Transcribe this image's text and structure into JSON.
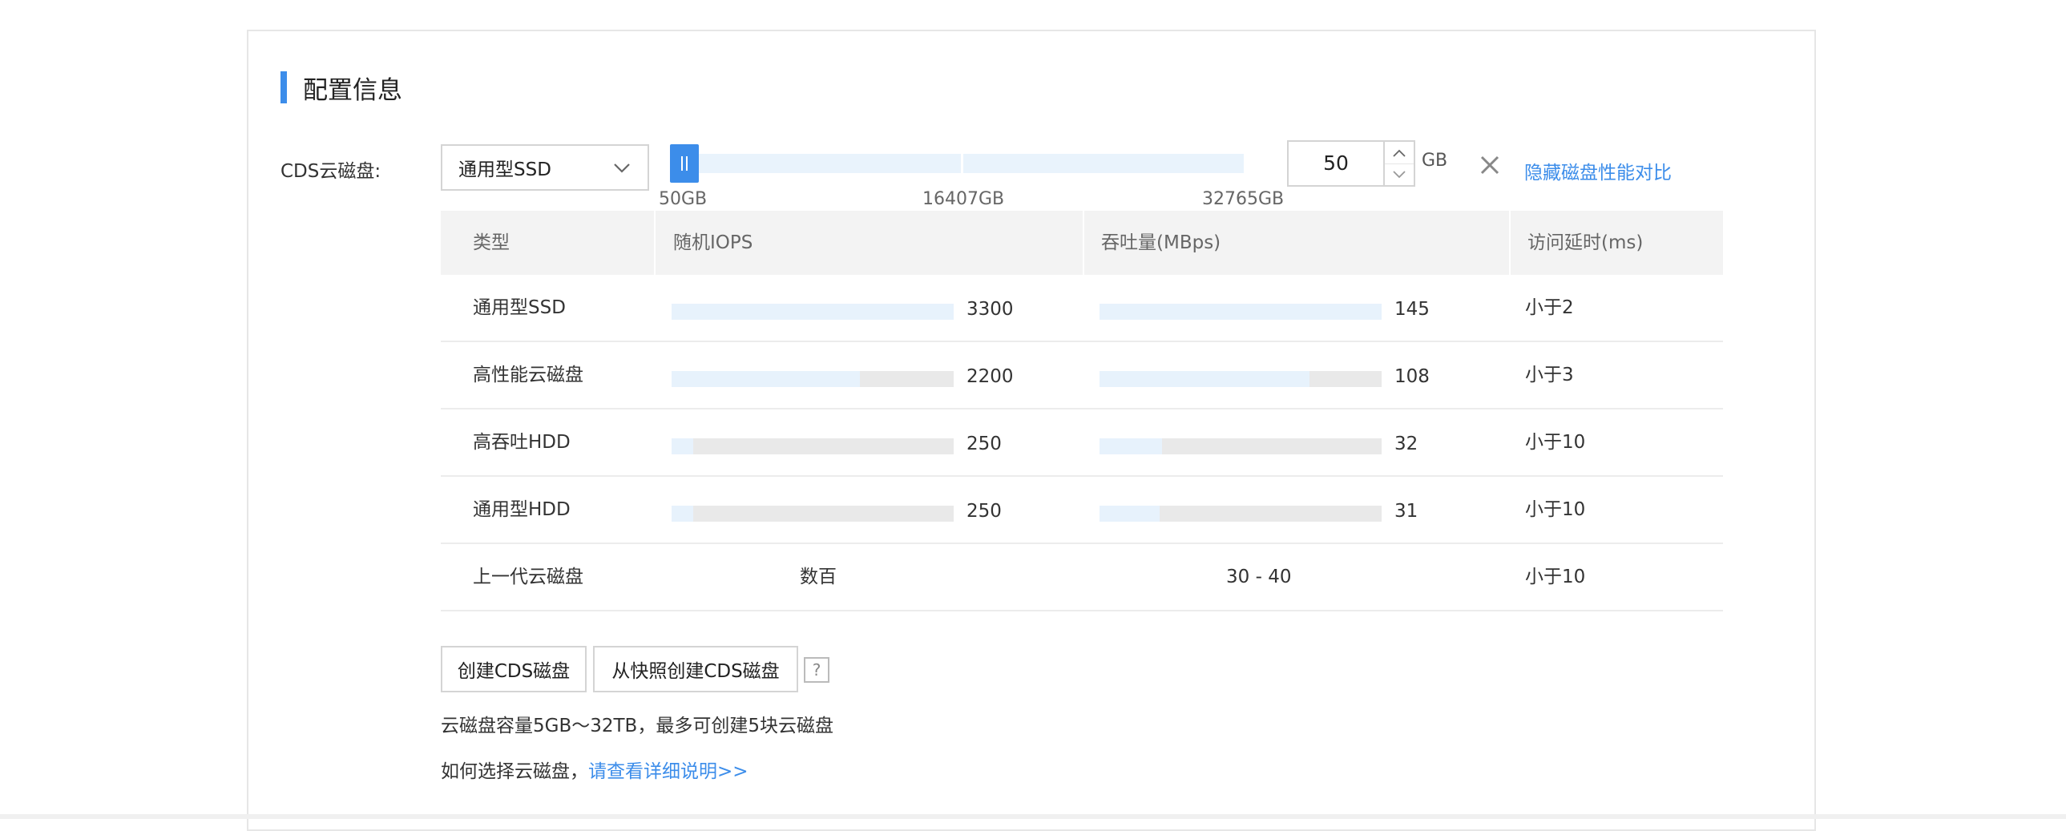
{
  "section": {
    "title": "配置信息"
  },
  "cds": {
    "label": "CDS云磁盘:",
    "disk_type_selected": "通用型SSD",
    "slider": {
      "ticks": [
        "50GB",
        "16407GB",
        "32765GB"
      ],
      "value_gb": 50,
      "min_gb": 50,
      "max_gb": 32765
    },
    "size_input_value": "50",
    "unit": "GB",
    "hide_compare_link": "隐藏磁盘性能对比"
  },
  "perf_table": {
    "headers": [
      "类型",
      "随机IOPS",
      "吞吐量(MBps)",
      "访问延时(ms)"
    ],
    "rows": [
      {
        "type": "通用型SSD",
        "iops": "3300",
        "iops_fill": 1.0,
        "throughput": "145",
        "throughput_fill": 1.0,
        "latency": "小于2"
      },
      {
        "type": "高性能云磁盘",
        "iops": "2200",
        "iops_fill": 0.667,
        "throughput": "108",
        "throughput_fill": 0.745,
        "latency": "小于3"
      },
      {
        "type": "高吞吐HDD",
        "iops": "250",
        "iops_fill": 0.076,
        "throughput": "32",
        "throughput_fill": 0.221,
        "latency": "小于10"
      },
      {
        "type": "通用型HDD",
        "iops": "250",
        "iops_fill": 0.076,
        "throughput": "31",
        "throughput_fill": 0.214,
        "latency": "小于10"
      }
    ],
    "legacy_row": {
      "type": "上一代云磁盘",
      "iops": "数百",
      "throughput": "30 - 40",
      "latency": "小于10"
    }
  },
  "actions": {
    "create_button": "创建CDS磁盘",
    "create_from_snapshot_button": "从快照创建CDS磁盘",
    "help": "?"
  },
  "notes": {
    "capacity": "云磁盘容量5GB～32TB，最多可创建5块云磁盘",
    "how_to_choose": "如何选择云磁盘，",
    "details_link": "请查看详细说明>>"
  },
  "colors": {
    "accent": "#3c8dea",
    "bar_fill": "#e7f2fc",
    "bar_bg": "#e9e9e9",
    "header_bg": "#f3f3f3"
  }
}
